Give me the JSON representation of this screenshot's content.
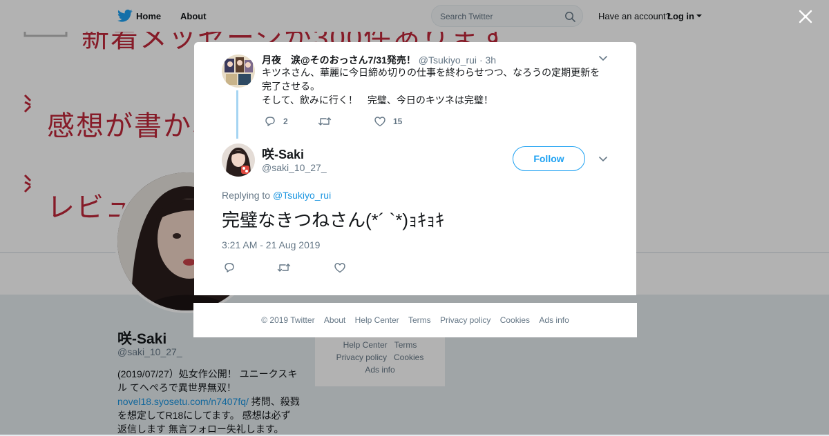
{
  "topbar": {
    "home_label": "Home",
    "about_label": "About",
    "search_placeholder": "Search Twitter",
    "have_account": "Have an account?",
    "login_label": "Log in"
  },
  "banner": {
    "line1": "新着メッセージが300件あります",
    "line2": "感想が書かれました",
    "line3": "レビューが書かれました"
  },
  "profile": {
    "name": "咲-Saki",
    "handle": "@saki_10_27_",
    "bio_start": "(2019/07/27）処女作公開！ ユニークスキル てへぺろで異世界無双！",
    "bio_link": "novel18.syosetu.com/n7407fq/",
    "bio_end": " 拷問、殺戮 を想定してR18にしてます。 感想は必ず返信します 無言フォロー失礼します。"
  },
  "side_footer": {
    "help_center": "Help Center",
    "terms": "Terms",
    "privacy": "Privacy policy",
    "cookies": "Cookies",
    "ads_info": "Ads info"
  },
  "parent_tweet": {
    "name": "月夜　涙@そのおっさん7/31発売！",
    "handle": "@Tsukiyo_rui",
    "time": "· 3h",
    "text_line1": "キツネさん、華麗に今日締め切りの仕事を終わらせつつ、なろうの定期更新を完了させる。",
    "text_line2": "そして、飲みに行く！　完璧、今日のキツネは完璧！",
    "reply_count": "2",
    "like_count": "15"
  },
  "main_tweet": {
    "name": "咲-Saki",
    "handle": "@saki_10_27_",
    "follow_label": "Follow",
    "replying_prefix": "Replying to",
    "replying_handle": "@Tsukiyo_rui",
    "text": "完璧なきつねさん(*´ ︎`*)ｮｷｮｷ",
    "timestamp": "3:21 AM - 21 Aug 2019"
  },
  "footer": {
    "copyright": "© 2019 Twitter",
    "about": "About",
    "help_center": "Help Center",
    "terms": "Terms",
    "privacy": "Privacy policy",
    "cookies": "Cookies",
    "ads_info": "Ads info"
  },
  "colors": {
    "brand_blue": "#1da1f2",
    "link_blue": "#1b95e0",
    "thread_line": "#a5d4f2",
    "banner_red": "#c0283a"
  },
  "icons": [
    "twitter-bird-icon",
    "search-icon",
    "close-icon",
    "chevron-down-icon",
    "reply-icon",
    "retweet-icon",
    "like-icon"
  ]
}
